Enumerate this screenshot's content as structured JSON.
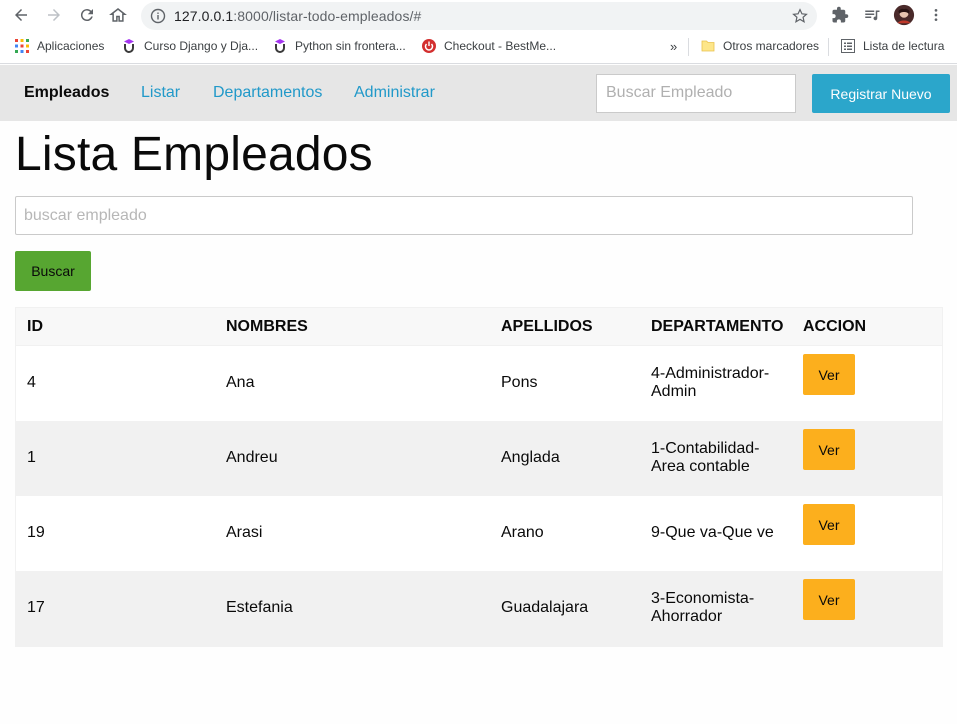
{
  "browser": {
    "url_host": "127.0.0.1",
    "url_rest": ":8000/listar-todo-empleados/#",
    "bookmarks": [
      {
        "label": "Aplicaciones"
      },
      {
        "label": "Curso Django y Dja..."
      },
      {
        "label": "Python sin frontera..."
      },
      {
        "label": "Checkout - BestMe..."
      }
    ],
    "overflow": "»",
    "other_bookmarks": "Otros marcadores",
    "reading_list": "Lista de lectura"
  },
  "navbar": {
    "brand": "Empleados",
    "links": [
      "Listar",
      "Departamentos",
      "Administrar"
    ],
    "search_placeholder": "Buscar Empleado",
    "register_label": "Registrar Nuevo"
  },
  "main": {
    "title": "Lista Empleados",
    "search_placeholder": "buscar empleado",
    "search_button": "Buscar"
  },
  "table": {
    "headers": [
      "ID",
      "NOMBRES",
      "APELLIDOS",
      "DEPARTAMENTO",
      "ACCION"
    ],
    "rows": [
      {
        "id": "4",
        "nombre": "Ana",
        "apellido": "Pons",
        "dept_line1": "4-Administrador-",
        "dept_line2": "Admin",
        "action": "Ver"
      },
      {
        "id": "1",
        "nombre": "Andreu",
        "apellido": "Anglada",
        "dept_line1": "1-Contabilidad-",
        "dept_line2": "Area contable",
        "action": "Ver"
      },
      {
        "id": "19",
        "nombre": "Arasi",
        "apellido": "Arano",
        "dept_line1": "9-Que va-Que ve",
        "dept_line2": "",
        "action": "Ver"
      },
      {
        "id": "17",
        "nombre": "Estefania",
        "apellido": "Guadalajara",
        "dept_line1": "3-Economista-",
        "dept_line2": "Ahorrador",
        "action": "Ver"
      }
    ]
  },
  "colors": {
    "navbar_bg": "#e6e6e6",
    "link": "#2199c9",
    "register_bg": "#2ba6cb",
    "search_button_bg": "#57a631",
    "action_button_bg": "#fcaf1d"
  }
}
